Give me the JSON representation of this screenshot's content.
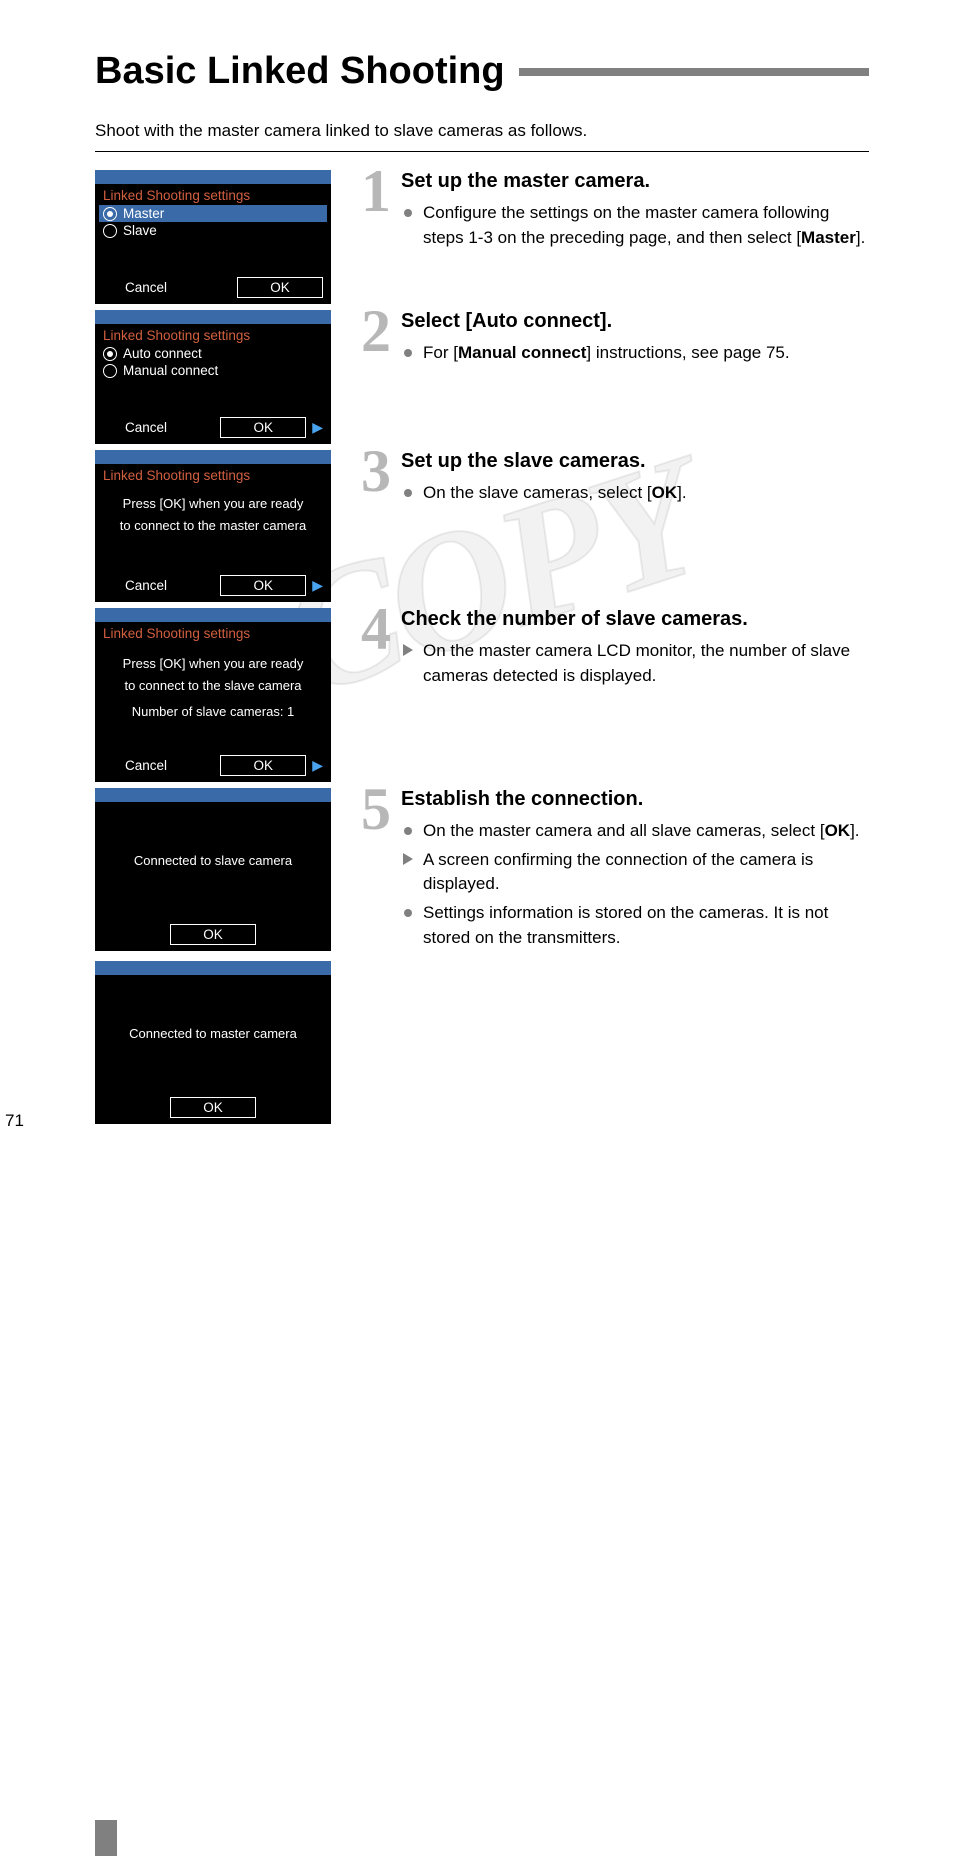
{
  "title": "Basic Linked Shooting",
  "intro": "Shoot with the master camera linked to slave cameras as follows.",
  "watermark": "COPY",
  "page_number": "71",
  "steps": [
    {
      "num": "1",
      "heading": "Set up the master camera.",
      "bullets": [
        {
          "type": "circle",
          "text_before": "Configure the settings on the master camera following steps 1-3 on the preceding page, and then select [",
          "bold": "Master",
          "text_after": "]."
        }
      ],
      "screen": {
        "title": "Linked Shooting settings",
        "options": [
          {
            "label": "Master",
            "selected": true,
            "filled": true
          },
          {
            "label": "Slave",
            "selected": false,
            "filled": false
          }
        ],
        "cancel": "Cancel",
        "ok": "OK",
        "ok_boxed": true,
        "arrow": false
      }
    },
    {
      "num": "2",
      "heading": "Select [Auto connect].",
      "bullets": [
        {
          "type": "circle",
          "text_before": "For [",
          "bold": "Manual connect",
          "text_after": "] instructions, see page 75."
        }
      ],
      "screen": {
        "title": "Linked Shooting settings",
        "options": [
          {
            "label": "Auto connect",
            "selected": false,
            "filled": true
          },
          {
            "label": "Manual connect",
            "selected": false,
            "filled": false
          }
        ],
        "cancel": "Cancel",
        "ok": "OK",
        "ok_boxed": true,
        "arrow": true
      }
    },
    {
      "num": "3",
      "heading": "Set up the slave cameras.",
      "bullets": [
        {
          "type": "circle",
          "text_before": "On the slave cameras, select [",
          "bold": "OK",
          "text_after": "]."
        }
      ],
      "screen": {
        "title": "Linked Shooting settings",
        "messages": [
          "Press [OK] when you are ready",
          "to connect to the master camera"
        ],
        "cancel": "Cancel",
        "ok": "OK",
        "ok_boxed": true,
        "arrow": true
      }
    },
    {
      "num": "4",
      "heading": "Check the number of slave cameras.",
      "bullets": [
        {
          "type": "triangle",
          "text_before": "On the master camera LCD monitor, the number of slave cameras detected is displayed.",
          "bold": "",
          "text_after": ""
        }
      ],
      "screen": {
        "title": "Linked Shooting settings",
        "messages": [
          "Press [OK] when you are ready",
          "to connect to the slave camera",
          "",
          "Number of slave cameras: 1"
        ],
        "cancel": "Cancel",
        "ok": "OK",
        "ok_boxed": true,
        "arrow": true
      }
    },
    {
      "num": "5",
      "heading": "Establish the connection.",
      "bullets": [
        {
          "type": "circle",
          "text_before": "On the master camera and all slave cameras, select [",
          "bold": "OK",
          "text_after": "]."
        },
        {
          "type": "triangle",
          "text_before": "A screen confirming the connection of the camera is displayed.",
          "bold": "",
          "text_after": ""
        },
        {
          "type": "circle",
          "text_before": "Settings information is stored on the cameras. It is not stored on the transmitters.",
          "bold": "",
          "text_after": ""
        }
      ],
      "screens": [
        {
          "messages": [
            "Connected to slave camera"
          ],
          "ok": "OK"
        },
        {
          "messages": [
            "Connected to master camera"
          ],
          "ok": "OK"
        }
      ]
    }
  ]
}
